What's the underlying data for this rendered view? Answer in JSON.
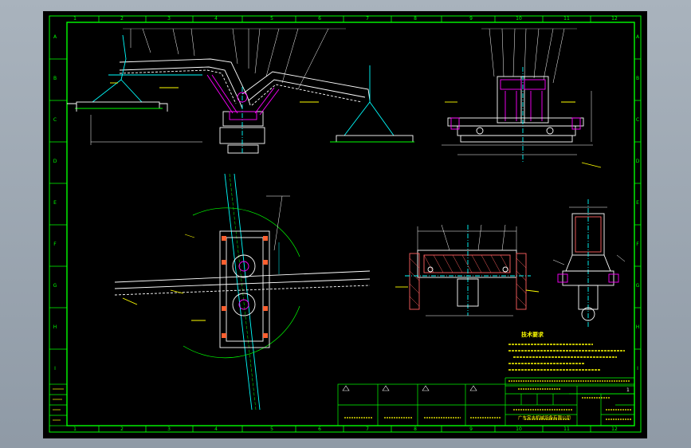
{
  "drawing": {
    "colors": {
      "background": "#000000",
      "frame": "#00ff00",
      "geometry": "#ffffff",
      "highlight": "#ff00ff",
      "dimension": "#00ffff",
      "annotation": "#ffff00",
      "hatch": "#ff6060",
      "app_background": "#9aa4ae"
    },
    "col_numbers": [
      "1",
      "2",
      "3",
      "4",
      "5",
      "6",
      "7",
      "8",
      "9",
      "10",
      "11",
      "12"
    ],
    "row_letters": [
      "A",
      "B",
      "C",
      "D",
      "E",
      "F",
      "G",
      "H",
      "I"
    ],
    "tech_req_title": "技术要求",
    "title_block": {
      "company": "广东宝丰机械设备有限公司",
      "sheet": "1"
    }
  }
}
